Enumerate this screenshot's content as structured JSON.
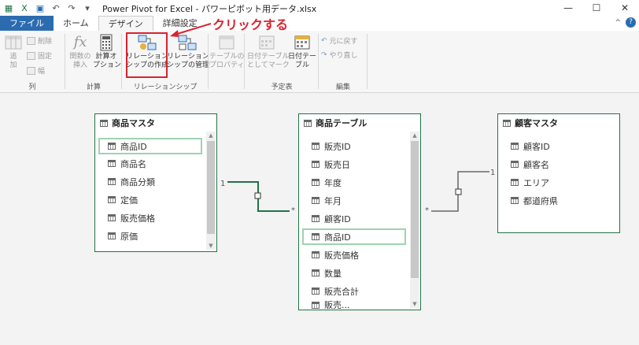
{
  "window": {
    "title": "Power Pivot for Excel - パワーピボット用データ.xlsx",
    "controls": [
      "—",
      "☐",
      "✕"
    ]
  },
  "tabs": [
    {
      "label": "ファイル"
    },
    {
      "label": "ホーム"
    },
    {
      "label": "デザイン"
    },
    {
      "label": "詳細設定"
    }
  ],
  "ribbon": {
    "groups": [
      {
        "label": "列",
        "buttons": [
          {
            "label": "追\n加"
          }
        ],
        "small": [
          "削除",
          "固定",
          "幅"
        ]
      },
      {
        "label": "計算",
        "buttons": [
          {
            "label": "関数の\n挿入"
          },
          {
            "label": "計算オ\nプション"
          }
        ]
      },
      {
        "label": "リレーションシップ",
        "buttons": [
          {
            "label": "リレーション\nシップの作成"
          },
          {
            "label": "リレーション\nシップの管理"
          }
        ]
      },
      {
        "label": "",
        "buttons": [
          {
            "label": "テーブルの\nプロパティ"
          }
        ]
      },
      {
        "label": "予定表",
        "buttons": [
          {
            "label": "日付テーブル\nとしてマーク"
          },
          {
            "label": "日付テー\nブル"
          }
        ]
      },
      {
        "label": "編集",
        "small": [
          "元に戻す",
          "やり直し"
        ]
      }
    ]
  },
  "annotation": {
    "text": "クリックする",
    "color": "#d9232e"
  },
  "tables": [
    {
      "name": "商品マスタ",
      "fields": [
        "商品ID",
        "商品名",
        "商品分類",
        "定価",
        "販売価格",
        "原価"
      ],
      "selected": "商品ID"
    },
    {
      "name": "商品テーブル",
      "fields": [
        "販売ID",
        "販売日",
        "年度",
        "年月",
        "顧客ID",
        "商品ID",
        "販売価格",
        "数量",
        "販売合計",
        "販売..."
      ],
      "selected": "商品ID"
    },
    {
      "name": "顧客マスタ",
      "fields": [
        "顧客ID",
        "顧客名",
        "エリア",
        "都道府県"
      ]
    }
  ],
  "relationships": [
    {
      "from": "商品マスタ",
      "to": "商品テーブル",
      "one": "1",
      "many": "*"
    },
    {
      "from": "顧客マスタ",
      "to": "商品テーブル",
      "one": "1",
      "many": "*"
    }
  ]
}
